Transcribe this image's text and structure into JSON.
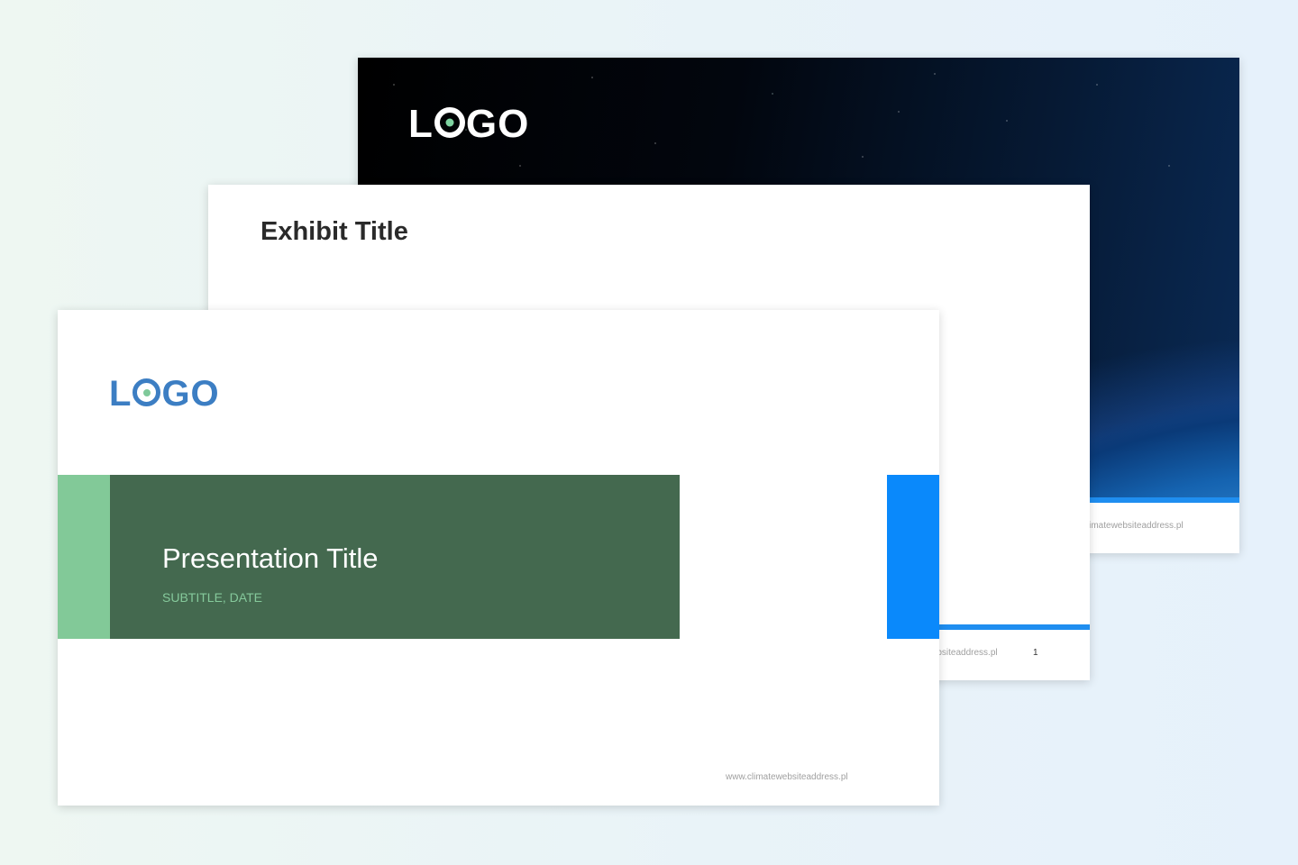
{
  "slides": {
    "back": {
      "logo_text": "LOGO",
      "footer_url": "www.climatewebsiteaddress.pl",
      "accent_color": "#1f8ef0"
    },
    "middle": {
      "title": "Exhibit Title",
      "footer_url": "www.climatewebsiteaddress.pl",
      "page_number": "1",
      "accent_color": "#1f8ef0"
    },
    "front": {
      "logo_text": "LOGO",
      "title": "Presentation Title",
      "subtitle": "SUBTITLE, DATE",
      "footer_url": "www.climatewebsiteaddress.pl",
      "band_color_light": "#82c998",
      "band_color_dark": "#44694f",
      "accent_color": "#0a89fb",
      "logo_color": "#3c7ec3"
    }
  }
}
